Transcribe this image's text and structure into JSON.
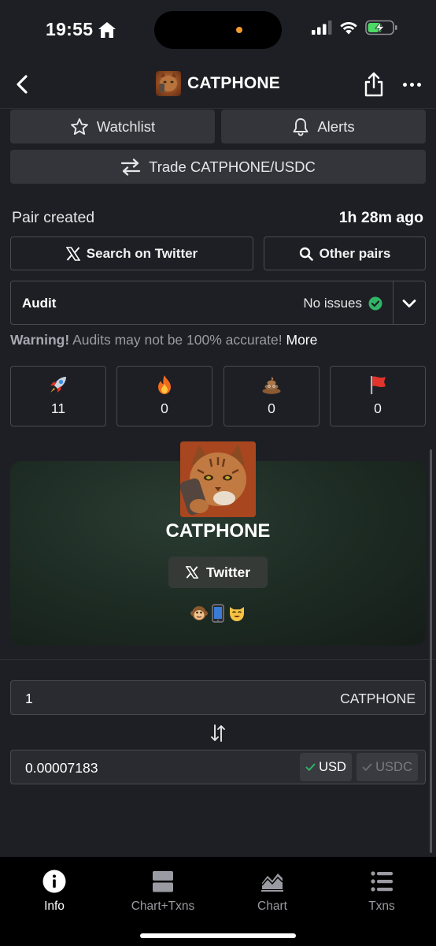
{
  "status_bar": {
    "time": "19:55"
  },
  "header": {
    "title": "CATPHONE"
  },
  "actions": {
    "watchlist_label": "Watchlist",
    "alerts_label": "Alerts",
    "trade_label": "Trade CATPHONE/USDC"
  },
  "pair": {
    "label": "Pair created",
    "value": "1h 28m ago"
  },
  "links": {
    "search_twitter_label": "Search on Twitter",
    "other_pairs_label": "Other pairs"
  },
  "audit": {
    "label": "Audit",
    "status": "No issues"
  },
  "warning": {
    "bold": "Warning!",
    "text": "Audits may not be 100% accurate!",
    "more": "More"
  },
  "reactions": [
    {
      "icon": "rocket-icon",
      "count": "11"
    },
    {
      "icon": "fire-icon",
      "count": "0"
    },
    {
      "icon": "poop-icon",
      "count": "0"
    },
    {
      "icon": "red-flag-icon",
      "count": "0"
    }
  ],
  "profile": {
    "name": "CATPHONE",
    "twitter_label": "Twitter",
    "emoji_icons": [
      "monkey-icon",
      "mobile-phone-icon",
      "cat-face-icon"
    ]
  },
  "converter": {
    "amount": "1",
    "token_symbol": "CATPHONE",
    "converted_value": "0.00007183",
    "currencies": [
      {
        "label": "USD",
        "selected": true
      },
      {
        "label": "USDC",
        "selected": false
      }
    ]
  },
  "tabbar": {
    "tabs": [
      {
        "label": "Info",
        "active": true
      },
      {
        "label": "Chart+Txns",
        "active": false
      },
      {
        "label": "Chart",
        "active": false
      },
      {
        "label": "Txns",
        "active": false
      }
    ]
  },
  "colors": {
    "background": "#1e1f24",
    "card_green": "#1c2a22",
    "success": "#2fb565",
    "flag_red": "#e0342c",
    "tabbar": "#000000"
  }
}
